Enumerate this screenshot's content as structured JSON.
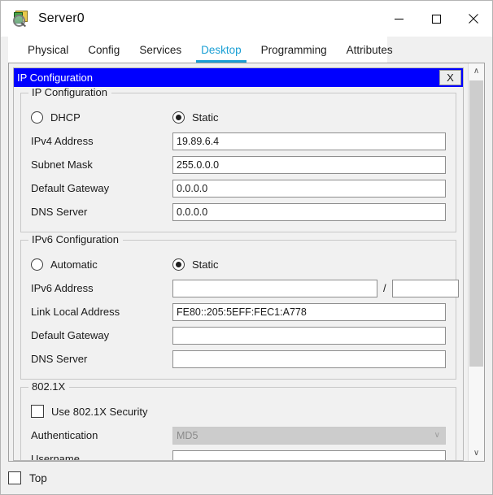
{
  "window": {
    "title": "Server0",
    "icon": "server-magnifier-icon",
    "minimize_label": "—",
    "maximize_label": "□",
    "close_label": "✕"
  },
  "tabs": [
    {
      "label": "Physical",
      "active": false
    },
    {
      "label": "Config",
      "active": false
    },
    {
      "label": "Services",
      "active": false
    },
    {
      "label": "Desktop",
      "active": true
    },
    {
      "label": "Programming",
      "active": false
    },
    {
      "label": "Attributes",
      "active": false
    }
  ],
  "dialog": {
    "title": "IP Configuration",
    "close_label": "X",
    "accent_color": "#0000ff"
  },
  "ipv4": {
    "group_title": "IP Configuration",
    "mode": {
      "dhcp_label": "DHCP",
      "dhcp_selected": false,
      "static_label": "Static",
      "static_selected": true
    },
    "fields": [
      {
        "label": "IPv4 Address",
        "value": "19.89.6.4"
      },
      {
        "label": "Subnet Mask",
        "value": "255.0.0.0"
      },
      {
        "label": "Default Gateway",
        "value": "0.0.0.0"
      },
      {
        "label": "DNS Server",
        "value": "0.0.0.0"
      }
    ]
  },
  "ipv6": {
    "group_title": "IPv6 Configuration",
    "mode": {
      "automatic_label": "Automatic",
      "automatic_selected": false,
      "static_label": "Static",
      "static_selected": true
    },
    "address_row": {
      "label": "IPv6 Address",
      "address_value": "",
      "separator": "/",
      "prefix_value": ""
    },
    "fields": [
      {
        "label": "Link Local Address",
        "value": "FE80::205:5EFF:FEC1:A778"
      },
      {
        "label": "Default Gateway",
        "value": ""
      },
      {
        "label": "DNS Server",
        "value": ""
      }
    ]
  },
  "dot1x": {
    "group_title": "802.1X",
    "use_security_label": "Use 802.1X Security",
    "use_security_checked": false,
    "authentication_label": "Authentication",
    "authentication_value": "MD5",
    "authentication_chevron": "∨",
    "username_label": "Username",
    "username_value": ""
  },
  "bottom": {
    "top_label": "Top",
    "top_checked": false
  },
  "scrollbar": {
    "up_arrow": "∧",
    "down_arrow": "∨"
  }
}
